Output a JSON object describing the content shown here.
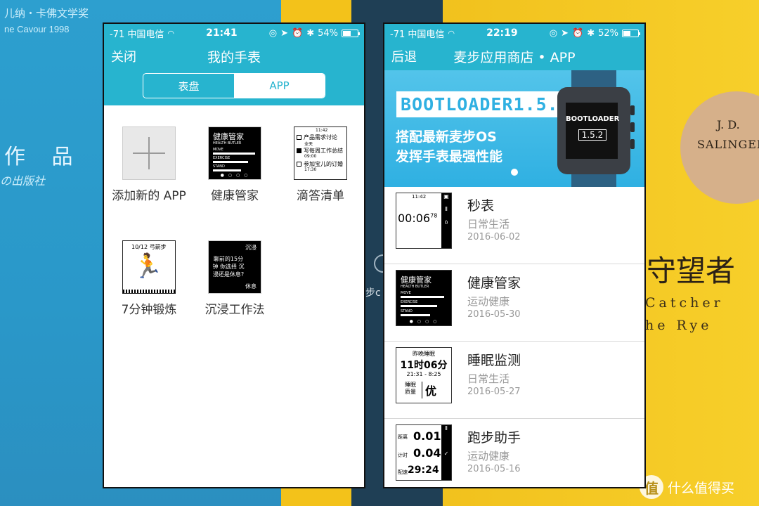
{
  "background": {
    "left_book_title": "儿纳・卡佛文学奖",
    "left_book_sub": "ne Cavour 1998",
    "left_book_big": "作 品",
    "left_book_pub": "の出版社",
    "right_book_author_1": "J. D.",
    "right_book_author_2": "SALINGER",
    "right_book_title_cn": "守望者",
    "right_book_title_en_1": "Catcher",
    "right_book_title_en_2": "he Rye",
    "strap_text": "步c",
    "watermark": "什么值得买",
    "watermark_icon": "值"
  },
  "left_phone": {
    "status": {
      "carrier": "-71 中国电信",
      "time": "21:41",
      "battery": "54%",
      "battery_level": 0.54
    },
    "nav": {
      "left_button": "关闭",
      "title": "我的手表"
    },
    "segments": {
      "left": "表盘",
      "right": "APP",
      "selected": "APP"
    },
    "apps": [
      {
        "label": "添加新的 APP"
      },
      {
        "label": "健康管家",
        "thumb": {
          "title": "健康管家",
          "sub": "HEALTH BUTLER",
          "rows": [
            "MOVE",
            "EXERCISE",
            "STAND"
          ]
        }
      },
      {
        "label": "滴答清单",
        "thumb": {
          "time": "11:42",
          "items": [
            "产品需求讨论",
            "全天",
            "写每周工作总结",
            "09:00",
            "参加宝儿的订婚",
            "17:30"
          ]
        }
      },
      {
        "label": "7分钟锻炼",
        "thumb": {
          "header": "10/12 弓箭步"
        }
      },
      {
        "label": "沉浸工作法",
        "thumb": {
          "top": "沉浸",
          "body": "聊前的15分钟 你选择 沉浸还是休息?",
          "bottom": "休息"
        }
      }
    ]
  },
  "right_phone": {
    "status": {
      "carrier": "-71 中国电信",
      "time": "22:19",
      "battery": "52%",
      "battery_level": 0.52
    },
    "nav": {
      "left_button": "后退",
      "title": "麦步应用商店 • APP"
    },
    "banner": {
      "title": "BOOTLOADER1.5.2",
      "line1": "搭配最新麦步OS",
      "line2": "发挥手表最强性能",
      "watch_label": "BOOTLOADER",
      "watch_version": "1.5.2"
    },
    "apps": [
      {
        "name": "秒表",
        "category": "日常生活",
        "date": "2016-06-02",
        "thumb": {
          "time": "11:42",
          "value": "00:06",
          "sup": "78"
        }
      },
      {
        "name": "健康管家",
        "category": "运动健康",
        "date": "2016-05-30",
        "thumb": {
          "title": "健康管家",
          "sub": "HEALTH BUTLER",
          "rows": [
            "MOVE",
            "EXERCISE",
            "STAND"
          ]
        }
      },
      {
        "name": "睡眠监测",
        "category": "日常生活",
        "date": "2016-05-27",
        "thumb": {
          "head": "昨晚睡眠",
          "value": "11时06分",
          "range": "21:31 - 8:25",
          "quality_label": "睡眠 质量",
          "quality": "优"
        }
      },
      {
        "name": "跑步助手",
        "category": "运动健康",
        "date": "2016-05-16",
        "thumb": {
          "rows": [
            [
              "距离",
              "0.01"
            ],
            [
              "计时",
              "0.04"
            ],
            [
              "配速",
              "29:24"
            ]
          ]
        }
      }
    ]
  }
}
